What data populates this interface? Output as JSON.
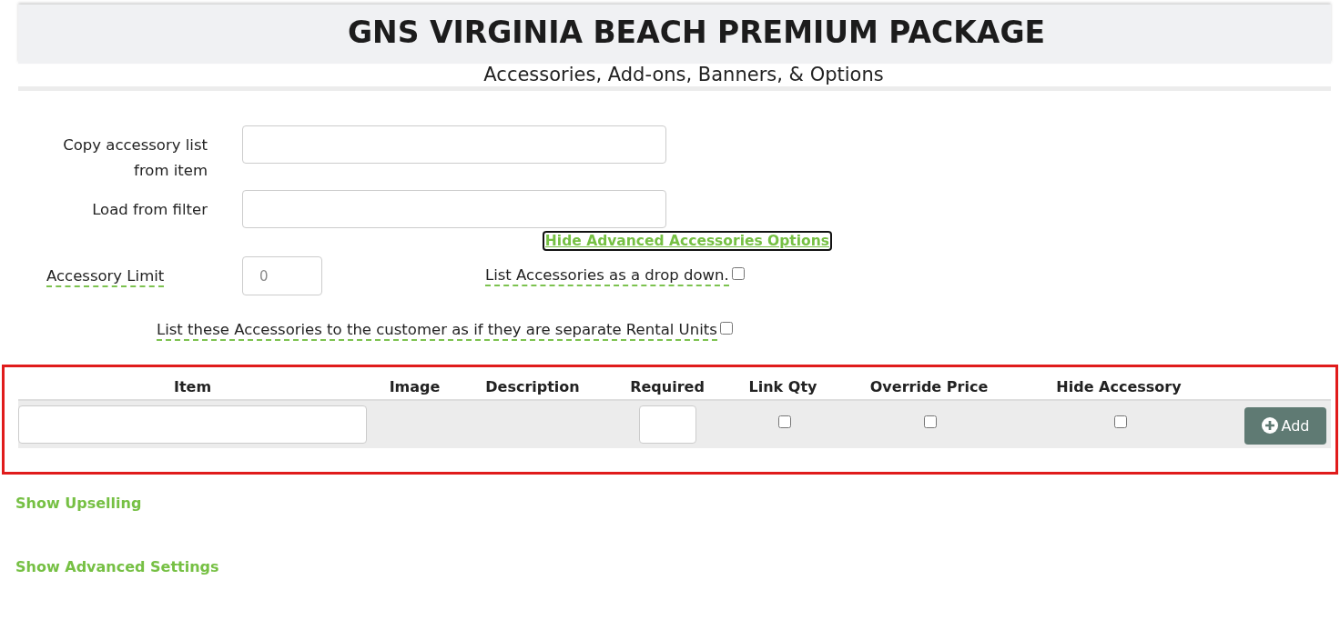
{
  "header": {
    "title": "GNS VIRGINIA BEACH PREMIUM PACKAGE",
    "subtitle": "Accessories, Add-ons, Banners, & Options"
  },
  "copy_fields": [
    {
      "label": "Copy accessory list from item",
      "hint": false
    },
    {
      "label": "Load from filter",
      "hint": false
    }
  ],
  "advanced_toggle": {
    "label": "Hide Advanced Accessories Options",
    "focused": true
  },
  "accessory_limit": {
    "label": "Accessory Limit",
    "hint": true,
    "placeholder": "0"
  },
  "options": [
    {
      "label": "List Accessories as a drop down.",
      "hint": true,
      "checked": false
    },
    {
      "label": "List these Accessories to the customer as if they are separate Rental Units",
      "hint": true,
      "checked": false
    }
  ],
  "accessory_table": {
    "highlighted": true,
    "columns": [
      "Item",
      "Image",
      "Description",
      "Required",
      "Link Qty",
      "Override Price",
      "Hide Accessory"
    ],
    "entry_row": [
      {
        "kind": "input"
      },
      {
        "kind": "blank"
      },
      {
        "kind": "blank"
      },
      {
        "kind": "input"
      },
      {
        "kind": "checkbox",
        "checked": false
      },
      {
        "kind": "checkbox",
        "checked": false
      },
      {
        "kind": "checkbox",
        "checked": false
      },
      {
        "kind": "button",
        "label": "Add"
      }
    ]
  },
  "links": [
    {
      "label": "Show Upselling"
    },
    {
      "label": "Show Advanced Settings"
    }
  ]
}
